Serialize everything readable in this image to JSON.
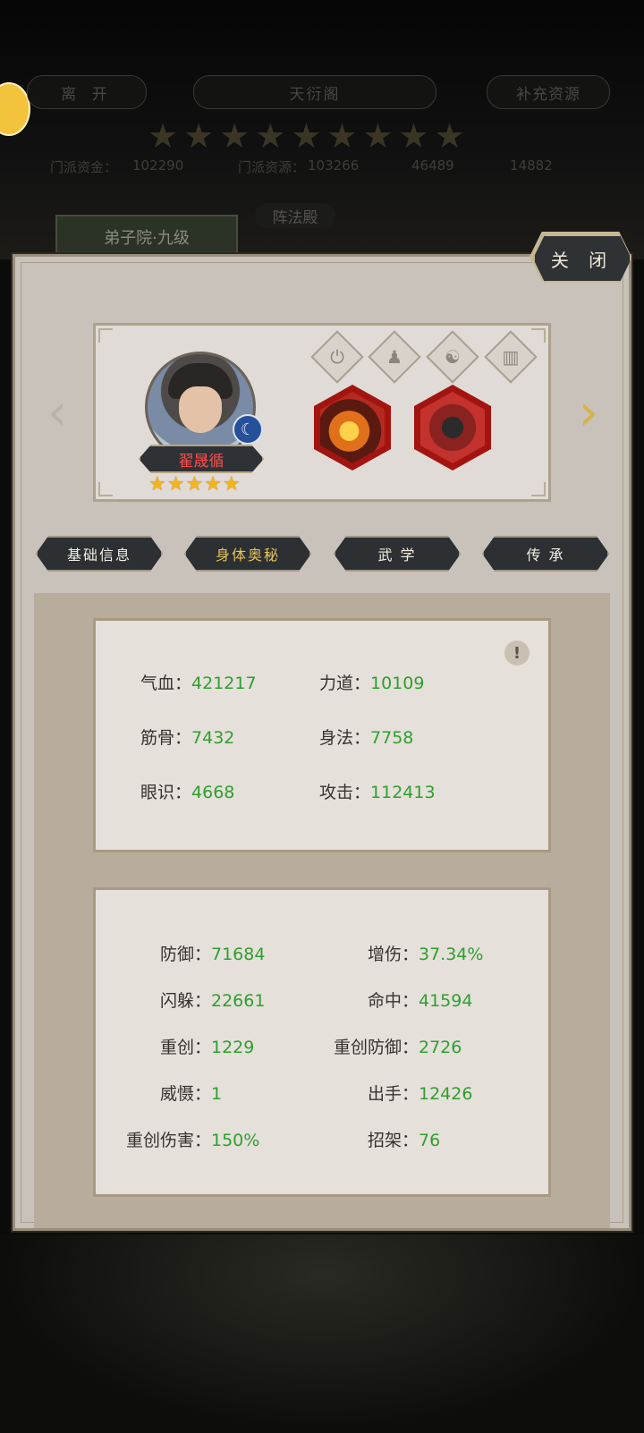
{
  "background": {
    "leave_label": "离 开",
    "title": "天衍阁",
    "supplement_label": "补充资源",
    "funds_label": "门派资金：",
    "funds_value": "102290",
    "resource_label": "门派资源：",
    "resource_value": "103266",
    "res3_value": "46489",
    "res4_value": "14882",
    "chip_label": "弟子院·九级",
    "hall_label": "阵法殿"
  },
  "close_label": "关 闭",
  "hero": {
    "name": "翟晟循",
    "stars": 5,
    "name_color": "#ff4d4d"
  },
  "tabs": [
    {
      "label": "基础信息"
    },
    {
      "label": "身体奥秘"
    },
    {
      "label": "武 学"
    },
    {
      "label": "传 承"
    }
  ],
  "basic_stats": [
    {
      "label": "气血：",
      "value": "421217"
    },
    {
      "label": "力道：",
      "value": "10109"
    },
    {
      "label": "筋骨：",
      "value": "7432"
    },
    {
      "label": "身法：",
      "value": "7758"
    },
    {
      "label": "眼识：",
      "value": "4668"
    },
    {
      "label": "攻击：",
      "value": "112413"
    }
  ],
  "combat_stats": [
    {
      "label": "防御：",
      "value": "71684"
    },
    {
      "label": "增伤：",
      "value": "37.34%"
    },
    {
      "label": "闪躲：",
      "value": "22661"
    },
    {
      "label": "命中：",
      "value": "41594"
    },
    {
      "label": "重创：",
      "value": "1229"
    },
    {
      "label": "重创防御：",
      "value": "2726"
    },
    {
      "label": "威慑：",
      "value": "1"
    },
    {
      "label": "出手：",
      "value": "12426"
    },
    {
      "label": "重创伤害：",
      "value": "150%"
    },
    {
      "label": "招架：",
      "value": "76"
    }
  ],
  "colors": {
    "value_green": "#2e9f2e",
    "active_tab": "#e8c65a"
  }
}
